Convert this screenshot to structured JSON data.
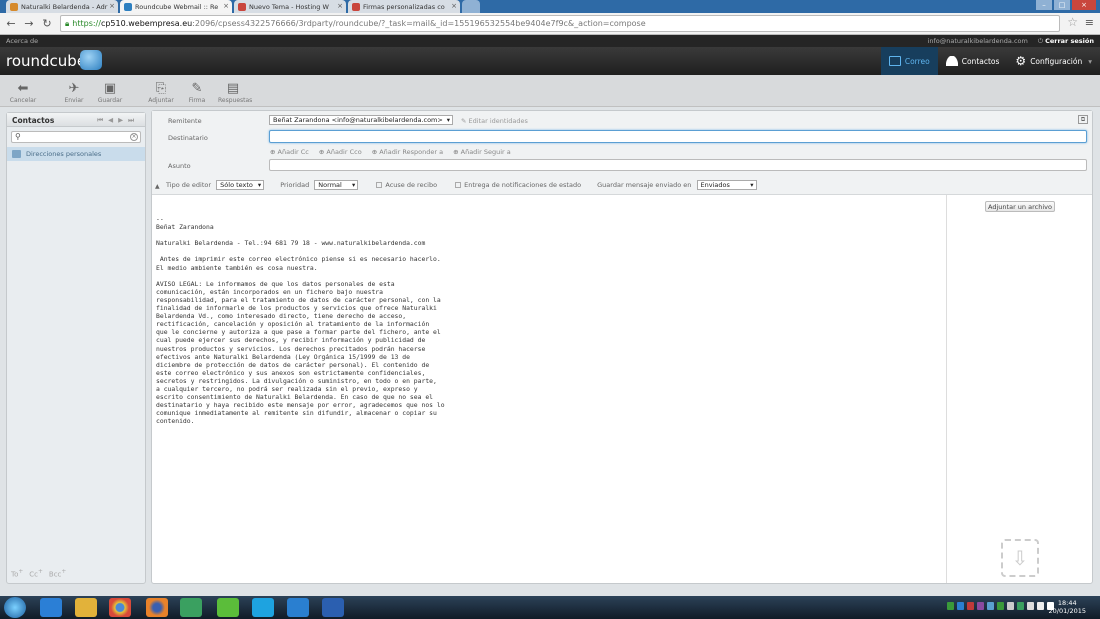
{
  "browser": {
    "tabs": [
      {
        "title": "Naturalki Belardenda - Adr",
        "active": false,
        "favicon_color": "#d68a2c"
      },
      {
        "title": "Roundcube Webmail :: Re",
        "active": true,
        "favicon_color": "#2d7fc0"
      },
      {
        "title": "Nuevo Tema - Hosting W",
        "active": false,
        "favicon_color": "#c9463d"
      },
      {
        "title": "Firmas personalizadas co",
        "active": false,
        "favicon_color": "#c9463d"
      }
    ],
    "url_scheme": "https://",
    "url_host": "cp510.webempresa.eu",
    "url_path": ":2096/cpsess4322576666/3rdparty/roundcube/?_task=mail&_id=155196532554be9404e7f9c&_action=compose"
  },
  "topbar": {
    "about": "Acerca de",
    "user_email": "info@naturalkibelardenda.com",
    "logout": "Cerrar sesión"
  },
  "header": {
    "logo": "roundcube",
    "nav": [
      {
        "label": "Correo",
        "icon": "mail-icon",
        "selected": true
      },
      {
        "label": "Contactos",
        "icon": "person-icon",
        "selected": false
      },
      {
        "label": "Configuración",
        "icon": "gear-icon",
        "selected": false
      }
    ]
  },
  "toolbar": {
    "cancel": "Cancelar",
    "send": "Enviar",
    "save": "Guardar",
    "attach": "Adjuntar",
    "signature": "Firma",
    "responses": "Respuestas"
  },
  "sidebar": {
    "title": "Contactos",
    "search_placeholder": "",
    "item": "Direcciones personales",
    "recipient_buttons": [
      "To",
      "Cc",
      "Bcc"
    ]
  },
  "compose": {
    "from_label": "Remitente",
    "from_value": "Beñat Zarandona <info@naturalkibelardenda.com>",
    "edit_identities": "Editar identidades",
    "to_label": "Destinatario",
    "to_value": "",
    "add_cc": "Añadir Cc",
    "add_bcc": "Añadir Cco",
    "add_replyto": "Añadir Responder a",
    "add_followupto": "Añadir Seguir a",
    "subject_label": "Asunto",
    "subject_value": "",
    "editor_type_label": "Tipo de editor",
    "editor_type_value": "Sólo texto",
    "priority_label": "Prioridad",
    "priority_value": "Normal",
    "receipt_label": "Acuse de recibo",
    "dsn_label": "Entrega de notificaciones de estado",
    "save_sent_label": "Guardar mensaje enviado en",
    "save_sent_value": "Enviados",
    "attach_button": "Adjuntar un archivo",
    "body": "--\nBeñat Zarandona\n\nNaturalki Belardenda - Tel.:94 681 79 18 - www.naturalkibelardenda.com\n\n Antes de imprimir este correo electrónico piense si es necesario hacerlo.\nEl medio ambiente también es cosa nuestra.\n\nAVISO LEGAL: Le informamos de que los datos personales de esta\ncomunicación, están incorporados en un fichero bajo nuestra\nresponsabilidad, para el tratamiento de datos de carácter personal, con la\nfinalidad de informarle de los productos y servicios que ofrece Naturalki\nBelardenda Vd., como interesado directo, tiene derecho de acceso,\nrectificación, cancelación y oposición al tratamiento de la información\nque le concierne y autoriza a que pase a formar parte del fichero, ante el\ncual puede ejercer sus derechos, y recibir información y publicidad de\nnuestros productos y servicios. Los derechos precitados podrán hacerse\nefectivos ante Naturalki Belardenda (Ley Orgánica 15/1999 de 13 de\ndiciembre de protección de datos de carácter personal). El contenido de\neste correo electrónico y sus anexos son estrictamente confidenciales,\nsecretos y restringidos. La divulgación o suministro, en todo o en parte,\na cualquier tercero, no podrá ser realizada sin el previo, expreso y\nescrito consentimiento de Naturalki Belardenda. En caso de que no sea el\ndestinatario y haya recibido este mensaje por error, agradecemos que nos lo\ncomunique inmediatamente al remitente sin difundir, almacenar o copiar su\ncontenido."
  },
  "taskbar": {
    "time": "18:44",
    "date": "20/01/2015"
  }
}
